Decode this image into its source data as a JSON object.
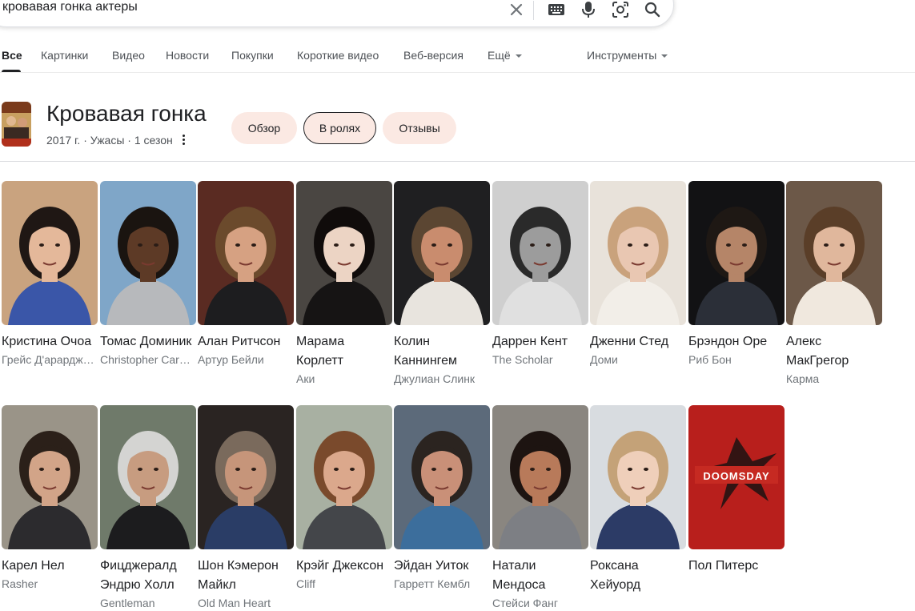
{
  "search": {
    "query": "кровавая гонка актеры"
  },
  "tabs": [
    {
      "label": "Все"
    },
    {
      "label": "Картинки"
    },
    {
      "label": "Видео"
    },
    {
      "label": "Новости"
    },
    {
      "label": "Покупки"
    },
    {
      "label": "Короткие видео"
    },
    {
      "label": "Веб-версия"
    },
    {
      "label": "Ещё"
    }
  ],
  "tools_label": "Инструменты",
  "entity": {
    "title": "Кровавая гонка",
    "meta": "2017 г. · Ужасы · 1 сезон",
    "chips": [
      {
        "label": "Обзор"
      },
      {
        "label": "В ролях"
      },
      {
        "label": "Отзывы"
      }
    ]
  },
  "cast": [
    {
      "name": "Кристина Очоа",
      "role": "Грейс Д'арардженто",
      "bg": "#c9a37f",
      "hair": "#1f1714",
      "skin": "#e4b89a",
      "cloth": "#3a56a8"
    },
    {
      "name": "Томас Доминик",
      "role": "Christopher Car…",
      "bg": "#7fa6c8",
      "hair": "#1a1410",
      "skin": "#5d3a26",
      "cloth": "#b7b9bc"
    },
    {
      "name": "Алан Ритчсон",
      "role": "Артур Бейли",
      "bg": "#5a2b22",
      "hair": "#6b4a2c",
      "skin": "#d6a182",
      "cloth": "#1d1d1f"
    },
    {
      "name": "Марама Корлетт",
      "role": "Аки",
      "bg": "#4a4642",
      "hair": "#100c0b",
      "skin": "#ecd4c4",
      "cloth": "#161414"
    },
    {
      "name": "Колин Каннингем",
      "role": "Джулиан Слинк",
      "bg": "#1f1f21",
      "hair": "#5b4632",
      "skin": "#c98c6e",
      "cloth": "#e8e4de"
    },
    {
      "name": "Даррен Кент",
      "role": "The Scholar",
      "bg": "#cfcfcf",
      "hair": "#2a2a2a",
      "skin": "#9c9c9c",
      "cloth": "#e0e0e0"
    },
    {
      "name": "Дженни Стед",
      "role": "Доми",
      "bg": "#e8e2da",
      "hair": "#c9a27c",
      "skin": "#e9c7b2",
      "cloth": "#f2eee8"
    },
    {
      "name": "Брэндон Оре",
      "role": "Риб Бон",
      "bg": "#121214",
      "hair": "#1e1814",
      "skin": "#b58568",
      "cloth": "#2b2f38"
    },
    {
      "name": "Алекс МакГрегор",
      "role": "Карма",
      "bg": "#6c5848",
      "hair": "#5a3e28",
      "skin": "#e0b79c",
      "cloth": "#f0e8de"
    },
    {
      "name": "Карел Нел",
      "role": "Rasher",
      "bg": "#9a9488",
      "hair": "#2b2019",
      "skin": "#d2a488",
      "cloth": "#2c2b2e"
    },
    {
      "name": "Фицджералд Эндрю Холл",
      "role": "Gentleman",
      "bg": "#6f7a6a",
      "hair": "#d4d4d2",
      "skin": "#c79c80",
      "cloth": "#1c1c1e"
    },
    {
      "name": "Шон Кэмерон Майкл",
      "role": "Old Man Heart",
      "bg": "#2a2422",
      "hair": "#7a6a5c",
      "skin": "#c6957a",
      "cloth": "#2a3d66"
    },
    {
      "name": "Крэйг Джексон",
      "role": "Cliff",
      "bg": "#a8b0a2",
      "hair": "#7a4a2c",
      "skin": "#dba88c",
      "cloth": "#44464a"
    },
    {
      "name": "Эйдан Уиток",
      "role": "Гарретт Кембл",
      "bg": "#5c6a7a",
      "hair": "#2b2420",
      "skin": "#c99078",
      "cloth": "#3c6e9c"
    },
    {
      "name": "Натали Мендоса",
      "role": "Стейси Фанг",
      "bg": "#8a8680",
      "hair": "#1d1411",
      "skin": "#b87a5a",
      "cloth": "#7d7f84"
    },
    {
      "name": "Роксана Хейуорд",
      "role": "",
      "bg": "#d8dce0",
      "hair": "#c4a278",
      "skin": "#efcfba",
      "cloth": "#2c3b66"
    },
    {
      "name": "Пол Питерс",
      "role": "",
      "bg": "#b81f1c",
      "hair": "#1a1a1a",
      "skin": "#1a1a1a",
      "cloth": "#1a1a1a",
      "poster": "DOOMSDAY"
    }
  ]
}
